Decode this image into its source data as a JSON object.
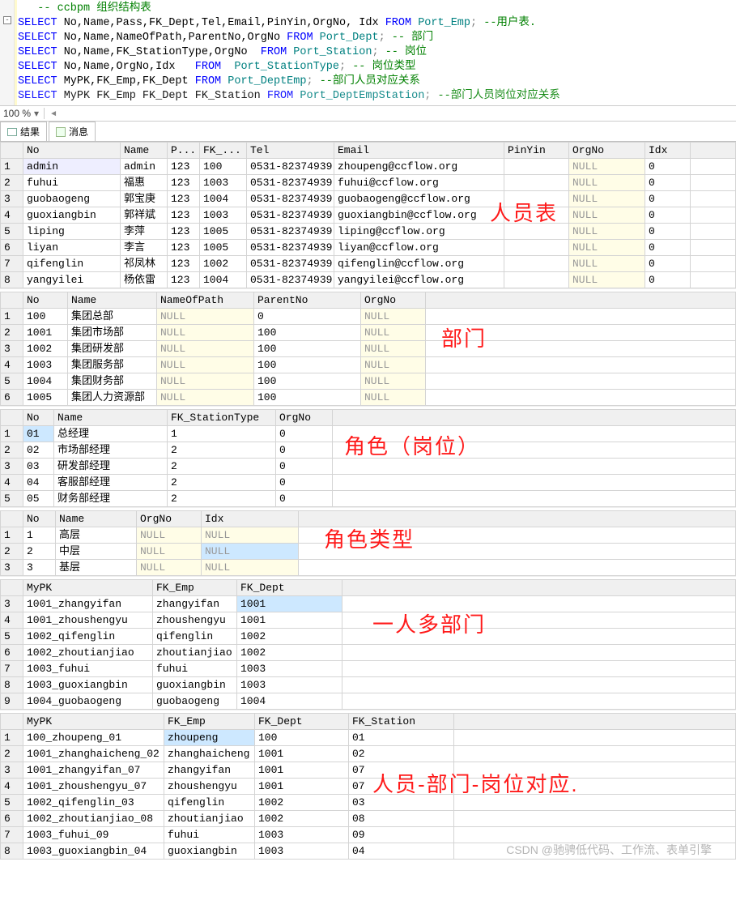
{
  "sql": {
    "comment_ccbpm": "   -- ccbpm 组织结构表",
    "line1_prefix": "SELECT",
    "line1_cols": " No,Name,Pass,FK_Dept,Tel,Email,PinYin,OrgNo, Idx ",
    "line1_from": "FROM",
    "line1_tbl": " Port_Emp",
    "line1_end": "; ",
    "line1_com": "--用户表.",
    "line2_prefix": "SELECT",
    "line2_cols": " No,Name,NameOfPath,ParentNo,OrgNo ",
    "line2_from": "FROM",
    "line2_tbl": " Port_Dept",
    "line2_end": "; ",
    "line2_com": "-- 部门",
    "line3_prefix": "SELECT",
    "line3_cols": " No,Name,FK_StationType,OrgNo  ",
    "line3_from": "FROM",
    "line3_tbl": " Port_Station",
    "line3_end": "; ",
    "line3_com": "-- 岗位",
    "line4_prefix": "SELECT",
    "line4_cols": " No,Name,OrgNo,Idx   ",
    "line4_from": "FROM",
    "line4_tbl": "  Port_StationType",
    "line4_end": "; ",
    "line4_com": "-- 岗位类型",
    "line5_prefix": "SELECT",
    "line5_cols": " MyPK,FK_Emp,FK_Dept ",
    "line5_from": "FROM",
    "line5_tbl": " Port_DeptEmp",
    "line5_end": "; ",
    "line5_com": "--部门人员对应关系",
    "line6_prefix": "SELECT",
    "line6_cols": " MyPK FK_Emp FK_Dept FK_Station ",
    "line6_from": "FROM",
    "line6_tbl": " Port_DeptEmpStation",
    "line6_end": "; ",
    "line6_com": "--部门人员岗位对应关系"
  },
  "zoom_level": "100 %",
  "tabs": {
    "results": "结果",
    "messages": "消息"
  },
  "overlays": {
    "emp": "人员表",
    "dept": "部门",
    "station": "角色（岗位）",
    "stationtype": "角色类型",
    "deptemp": "一人多部门",
    "deptempstation": "人员-部门-岗位对应."
  },
  "watermark": "CSDN @驰骋低代码、工作流、表单引擎",
  "null_text": "NULL",
  "grid_emp": {
    "headers": [
      "No",
      "Name",
      "P...",
      "FK_...",
      "Tel",
      "Email",
      "PinYin",
      "OrgNo",
      "Idx"
    ],
    "rows": [
      [
        "admin",
        "admin",
        "123",
        "100",
        "0531-82374939",
        "zhoupeng@ccflow.org",
        "",
        "NULL",
        "0"
      ],
      [
        "fuhui",
        "福惠",
        "123",
        "1003",
        "0531-82374939",
        "fuhui@ccflow.org",
        "",
        "NULL",
        "0"
      ],
      [
        "guobaogeng",
        "郭宝庚",
        "123",
        "1004",
        "0531-82374939",
        "guobaogeng@ccflow.org",
        "",
        "NULL",
        "0"
      ],
      [
        "guoxiangbin",
        "郭祥斌",
        "123",
        "1003",
        "0531-82374939",
        "guoxiangbin@ccflow.org",
        "",
        "NULL",
        "0"
      ],
      [
        "liping",
        "李萍",
        "123",
        "1005",
        "0531-82374939",
        "liping@ccflow.org",
        "",
        "NULL",
        "0"
      ],
      [
        "liyan",
        "李言",
        "123",
        "1005",
        "0531-82374939",
        "liyan@ccflow.org",
        "",
        "NULL",
        "0"
      ],
      [
        "qifenglin",
        "祁凤林",
        "123",
        "1002",
        "0531-82374939",
        "qifenglin@ccflow.org",
        "",
        "NULL",
        "0"
      ],
      [
        "yangyilei",
        "杨依雷",
        "123",
        "1004",
        "0531-82374939",
        "yangyilei@ccflow.org",
        "",
        "NULL",
        "0"
      ]
    ]
  },
  "grid_dept": {
    "headers": [
      "No",
      "Name",
      "NameOfPath",
      "ParentNo",
      "OrgNo"
    ],
    "rows": [
      [
        "100",
        "集团总部",
        "NULL",
        "0",
        "NULL"
      ],
      [
        "1001",
        "集团市场部",
        "NULL",
        "100",
        "NULL"
      ],
      [
        "1002",
        "集团研发部",
        "NULL",
        "100",
        "NULL"
      ],
      [
        "1003",
        "集团服务部",
        "NULL",
        "100",
        "NULL"
      ],
      [
        "1004",
        "集团财务部",
        "NULL",
        "100",
        "NULL"
      ],
      [
        "1005",
        "集团人力资源部",
        "NULL",
        "100",
        "NULL"
      ]
    ]
  },
  "grid_station": {
    "headers": [
      "No",
      "Name",
      "FK_StationType",
      "OrgNo"
    ],
    "rows": [
      [
        "01",
        "总经理",
        "1",
        "0"
      ],
      [
        "02",
        "市场部经理",
        "2",
        "0"
      ],
      [
        "03",
        "研发部经理",
        "2",
        "0"
      ],
      [
        "04",
        "客服部经理",
        "2",
        "0"
      ],
      [
        "05",
        "财务部经理",
        "2",
        "0"
      ]
    ]
  },
  "grid_stationtype": {
    "headers": [
      "No",
      "Name",
      "OrgNo",
      "Idx"
    ],
    "rows": [
      [
        "1",
        "高层",
        "NULL",
        "NULL"
      ],
      [
        "2",
        "中层",
        "NULL",
        "NULL"
      ],
      [
        "3",
        "基层",
        "NULL",
        "NULL"
      ]
    ]
  },
  "grid_deptemp": {
    "headers": [
      "MyPK",
      "FK_Emp",
      "FK_Dept"
    ],
    "start": 3,
    "rows": [
      [
        "1001_zhangyifan",
        "zhangyifan",
        "1001"
      ],
      [
        "1001_zhoushengyu",
        "zhoushengyu",
        "1001"
      ],
      [
        "1002_qifenglin",
        "qifenglin",
        "1002"
      ],
      [
        "1002_zhoutianjiao",
        "zhoutianjiao",
        "1002"
      ],
      [
        "1003_fuhui",
        "fuhui",
        "1003"
      ],
      [
        "1003_guoxiangbin",
        "guoxiangbin",
        "1003"
      ],
      [
        "1004_guobaogeng",
        "guobaogeng",
        "1004"
      ]
    ]
  },
  "grid_deptempstation": {
    "headers": [
      "MyPK",
      "FK_Emp",
      "FK_Dept",
      "FK_Station"
    ],
    "rows": [
      [
        "100_zhoupeng_01",
        "zhoupeng",
        "100",
        "01"
      ],
      [
        "1001_zhanghaicheng_02",
        "zhanghaicheng",
        "1001",
        "02"
      ],
      [
        "1001_zhangyifan_07",
        "zhangyifan",
        "1001",
        "07"
      ],
      [
        "1001_zhoushengyu_07",
        "zhoushengyu",
        "1001",
        "07"
      ],
      [
        "1002_qifenglin_03",
        "qifenglin",
        "1002",
        "03"
      ],
      [
        "1002_zhoutianjiao_08",
        "zhoutianjiao",
        "1002",
        "08"
      ],
      [
        "1003_fuhui_09",
        "fuhui",
        "1003",
        "09"
      ],
      [
        "1003_guoxiangbin_04",
        "guoxiangbin",
        "1003",
        "04"
      ]
    ]
  }
}
